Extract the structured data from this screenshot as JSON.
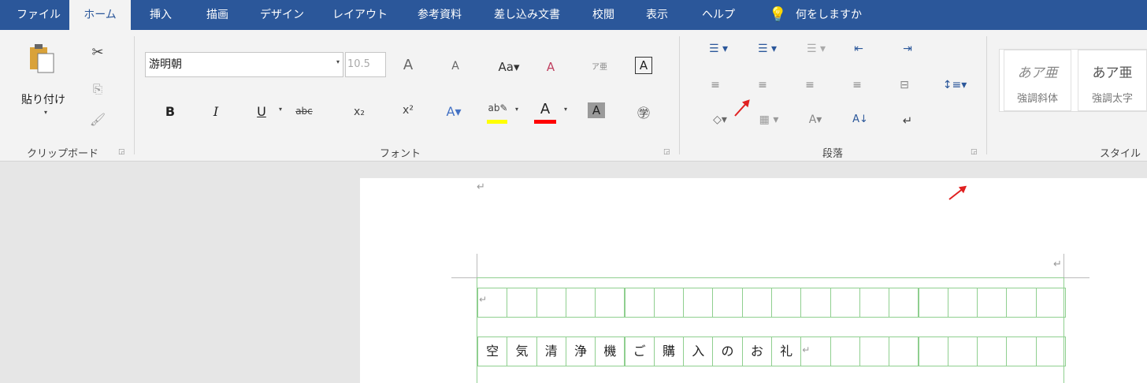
{
  "tabs": [
    "ファイル",
    "ホーム",
    "挿入",
    "描画",
    "デザイン",
    "レイアウト",
    "参考資料",
    "差し込み文書",
    "校閲",
    "表示",
    "ヘルプ"
  ],
  "tell_me": "何をしますか",
  "clipboard": {
    "paste_label": "貼り付け",
    "group_label": "クリップボード"
  },
  "font": {
    "name": "游明朝",
    "size": "10.5",
    "group_label": "フォント"
  },
  "paragraph": {
    "group_label": "段落"
  },
  "styles": {
    "group_label": "スタイル",
    "items": [
      {
        "sample": "あア亜",
        "name": "強調斜体"
      },
      {
        "sample": "あア亜",
        "name": "強調太字"
      }
    ]
  },
  "document": {
    "title_chars": [
      "空",
      "気",
      "清",
      "浄",
      "機",
      "ご",
      "購",
      "入",
      "の",
      "お",
      "礼"
    ],
    "paragraph_mark": "↵"
  },
  "colors": {
    "ribbon_blue": "#2b579a",
    "highlight": "#ffff00",
    "font_color": "#ff0000",
    "grid": "#8fcf8f",
    "annotation_arrow": "#e02020"
  }
}
